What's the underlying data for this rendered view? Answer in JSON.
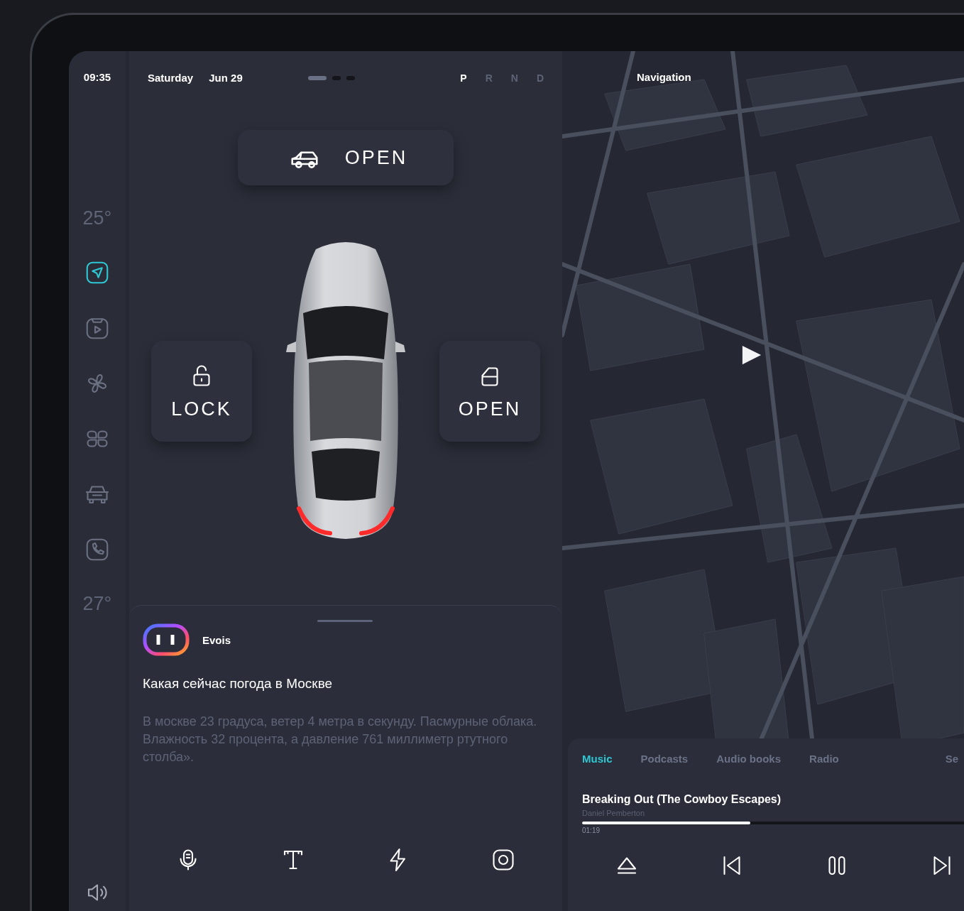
{
  "status": {
    "time": "09:35",
    "day": "Saturday",
    "date": "Jun 29"
  },
  "pager": [
    {
      "selected": true
    },
    {
      "selected": false
    },
    {
      "selected": false
    }
  ],
  "gears": [
    {
      "label": "P",
      "selected": true
    },
    {
      "label": "R",
      "selected": false
    },
    {
      "label": "N",
      "selected": false
    },
    {
      "label": "D",
      "selected": false
    }
  ],
  "sidebar": {
    "temp_top": "25°",
    "items": [
      {
        "kind": "navigation",
        "selected": true
      },
      {
        "kind": "media",
        "selected": false
      },
      {
        "kind": "climate",
        "selected": false
      },
      {
        "kind": "apps",
        "selected": false
      },
      {
        "kind": "car",
        "selected": false
      },
      {
        "kind": "phone",
        "selected": false
      }
    ],
    "temp_bottom": "27°"
  },
  "trunk_button": {
    "label": "OPEN"
  },
  "lock_button": {
    "label": "LOCK"
  },
  "door_button": {
    "label": "OPEN"
  },
  "assistant": {
    "name": "Evois",
    "query": "Какая сейчас погода в Москве",
    "answer": "В москве 23 градуса, ветер 4 метра в секунду. Пасмурные облака. Влажность 32 процента, а давление 761 миллиметр ртутного столба».",
    "actions": [
      {
        "kind": "mic"
      },
      {
        "kind": "text"
      },
      {
        "kind": "bolt"
      },
      {
        "kind": "camera"
      }
    ]
  },
  "navigation": {
    "title": "Navigation"
  },
  "player": {
    "tabs": [
      {
        "label": "Music",
        "selected": true
      },
      {
        "label": "Podcasts",
        "selected": false
      },
      {
        "label": "Audio books",
        "selected": false
      },
      {
        "label": "Radio",
        "selected": false
      },
      {
        "label": "Se",
        "selected": false
      }
    ],
    "track": "Breaking Out (The Cowboy Escapes)",
    "artist": "Daniel Pemberton",
    "elapsed": "01:19",
    "level": 0.44,
    "controls": [
      {
        "kind": "eject"
      },
      {
        "kind": "previous"
      },
      {
        "kind": "pause"
      },
      {
        "kind": "next"
      }
    ]
  }
}
